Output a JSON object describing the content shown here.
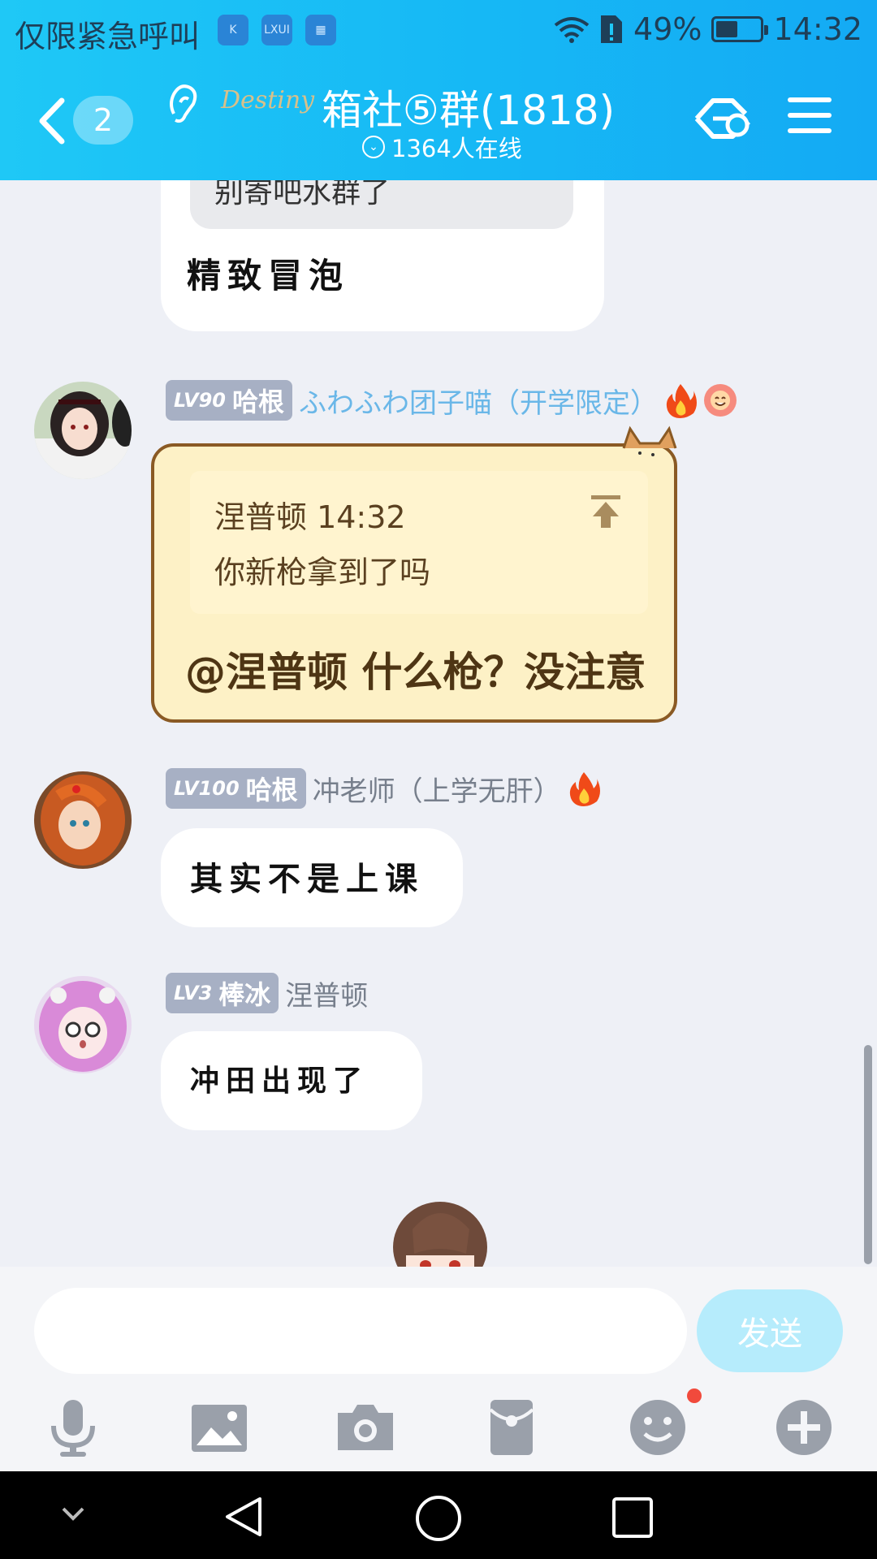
{
  "status_bar": {
    "carrier_text": "仅限紧急呼叫",
    "app_icons": [
      "K",
      "LXUI",
      "gallery-icon"
    ],
    "battery": "49%",
    "battery_level": 0.49,
    "time": "14:32"
  },
  "header": {
    "back_count": "2",
    "logo_text": "Destiny",
    "group_title": "箱社⑤群(1818)",
    "online": "1364人在线"
  },
  "messages": [
    {
      "quote_cut": "别寄吧水群了",
      "text": "精致冒泡"
    },
    {
      "level": "LV90",
      "title": "哈根",
      "nickname": "ふわふわ团子喵（开学限定）",
      "reply_name_time": "涅普顿 14:32",
      "reply_text": "你新枪拿到了吗",
      "text": "@涅普顿 什么枪？没注意"
    },
    {
      "level": "LV100",
      "title": "哈根",
      "nickname": "冲老师（上学无肝）",
      "text": "其实不是上课"
    },
    {
      "level": "LV3",
      "title": "棒冰",
      "nickname": "涅普顿",
      "text": "冲田出现了"
    }
  ],
  "input": {
    "placeholder": "",
    "send_label": "发送"
  },
  "colors": {
    "header": "#16b8f5",
    "cat_bubble": "#fdf1c6",
    "cat_border": "#8a5a24",
    "send_button": "#b6ecfc",
    "notification_dot": "#f14a3c"
  }
}
